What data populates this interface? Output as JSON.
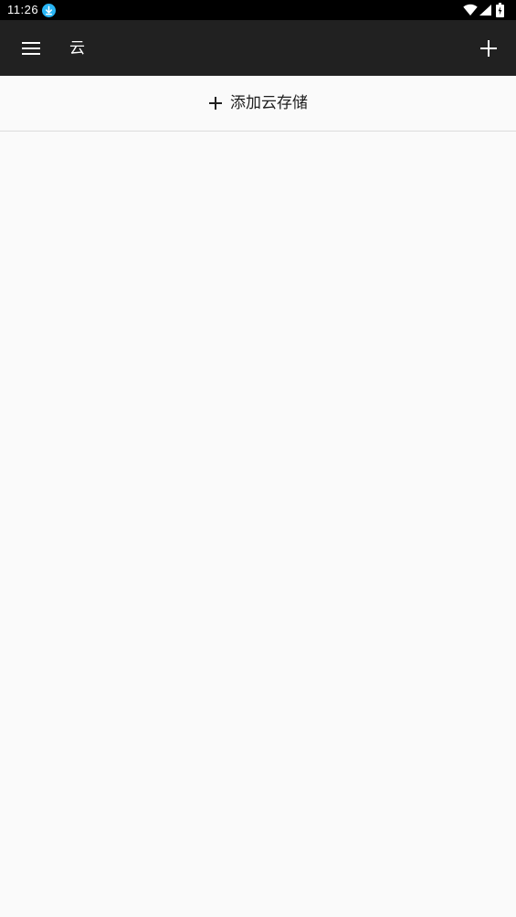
{
  "status_bar": {
    "time": "11:26",
    "icons": [
      "download-icon",
      "wifi-icon",
      "cellular-signal-icon",
      "battery-charging-icon"
    ],
    "download_color": "#29b6f6"
  },
  "app_bar": {
    "title": "云",
    "background": "#212121",
    "left_icon": "menu-icon",
    "right_icon": "plus-icon"
  },
  "main": {
    "add_storage_label": "添加云存储",
    "add_storage_icon": "plus-icon"
  }
}
